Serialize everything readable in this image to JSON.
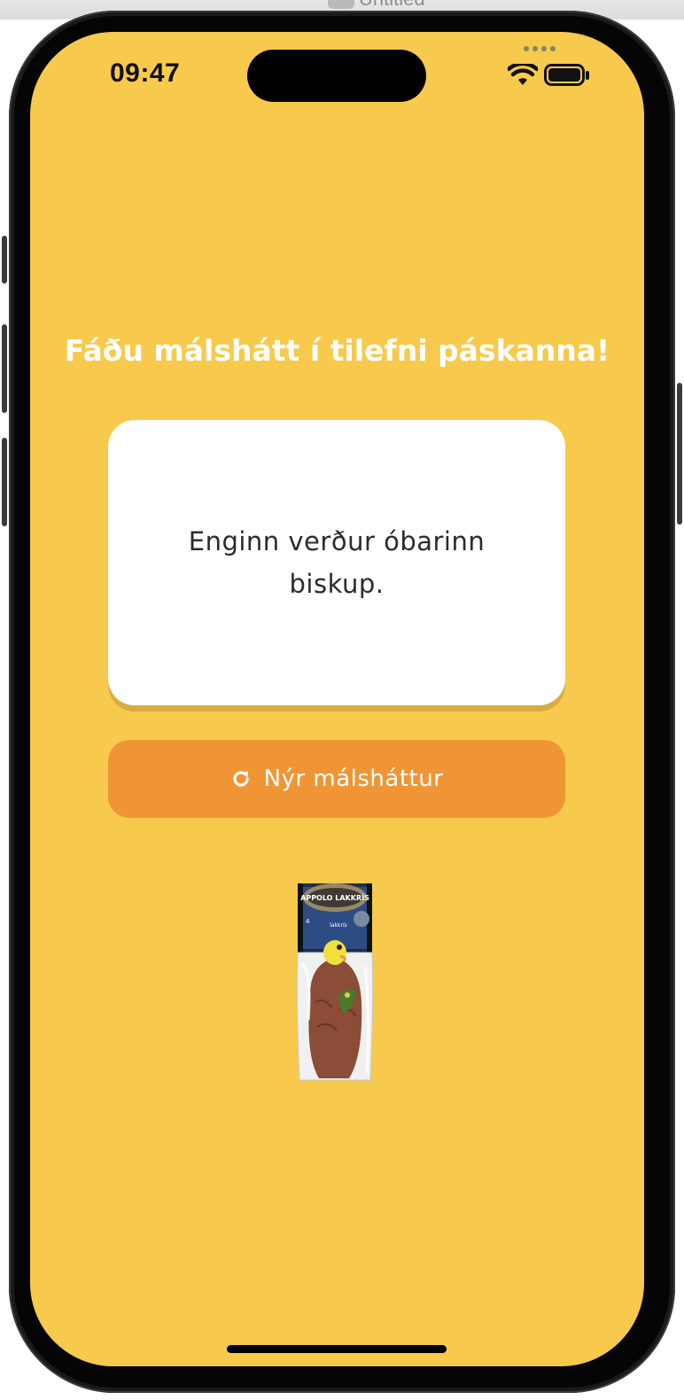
{
  "window": {
    "title": "Untitled"
  },
  "status_bar": {
    "time": "09:47",
    "icons": [
      "cellular-dots-icon",
      "wifi-icon",
      "battery-icon"
    ]
  },
  "main": {
    "headline": "Fáðu málshátt í tilefni páskanna!",
    "proverb": "Enginn verður óbarinn biskup.",
    "new_button": {
      "label": "Nýr málsháttur",
      "icon": "refresh-icon"
    },
    "product_image": {
      "name": "easter-egg-image",
      "brand_text": "APPOLO LAKKRÍS",
      "sub_text": "lakkrís",
      "size_text": "4"
    }
  },
  "colors": {
    "background": "#f7c94d",
    "button": "#f09535",
    "card": "#ffffff",
    "headline": "#ffffff"
  }
}
